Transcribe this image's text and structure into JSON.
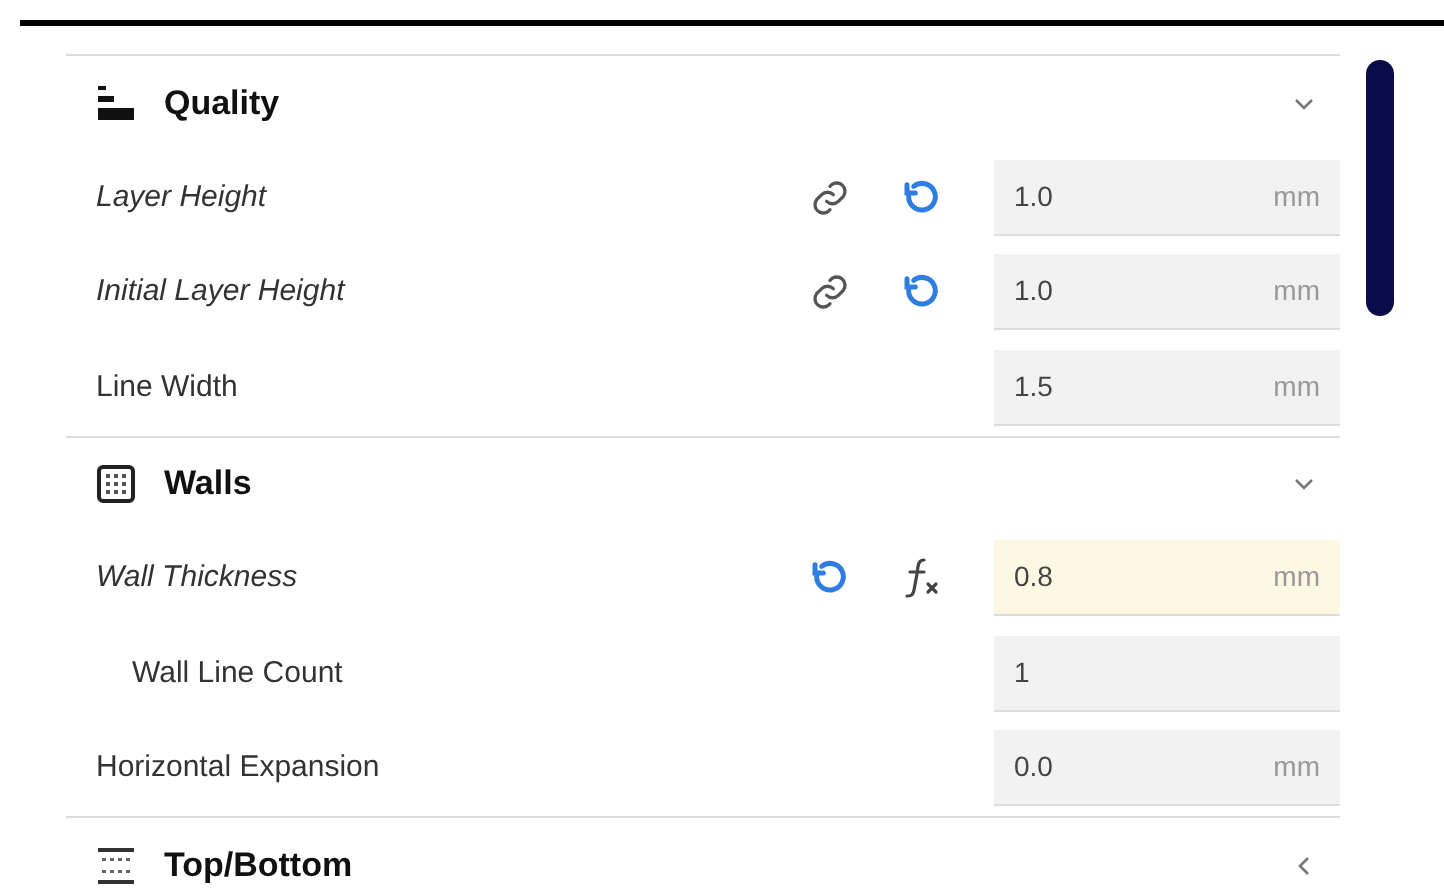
{
  "sections": [
    {
      "title": "Quality",
      "kind": "quality",
      "expanded": true,
      "settings": [
        {
          "label": "Layer Height",
          "modified": true,
          "icons": [
            {
              "kind": "link"
            },
            {
              "kind": "reset"
            }
          ],
          "value": "1.0",
          "unit": "mm",
          "highlighted": false
        },
        {
          "label": "Initial Layer Height",
          "modified": true,
          "icons": [
            {
              "kind": "link"
            },
            {
              "kind": "reset"
            }
          ],
          "value": "1.0",
          "unit": "mm",
          "highlighted": false
        },
        {
          "label": "Line Width",
          "modified": false,
          "value": "1.5",
          "unit": "mm",
          "highlighted": false
        }
      ]
    },
    {
      "title": "Walls",
      "kind": "walls",
      "expanded": true,
      "settings": [
        {
          "label": "Wall Thickness",
          "modified": true,
          "icons": [
            {
              "kind": "reset"
            },
            {
              "kind": "formula"
            }
          ],
          "value": "0.8",
          "unit": "mm",
          "highlighted": true,
          "children": [
            {
              "label": "Wall Line Count",
              "modified": false,
              "value": "1",
              "highlighted": false
            }
          ]
        },
        {
          "label": "Horizontal Expansion",
          "modified": false,
          "value": "0.0",
          "unit": "mm",
          "highlighted": false
        }
      ]
    },
    {
      "title": "Top/Bottom",
      "kind": "topbottom",
      "expanded": false
    }
  ]
}
